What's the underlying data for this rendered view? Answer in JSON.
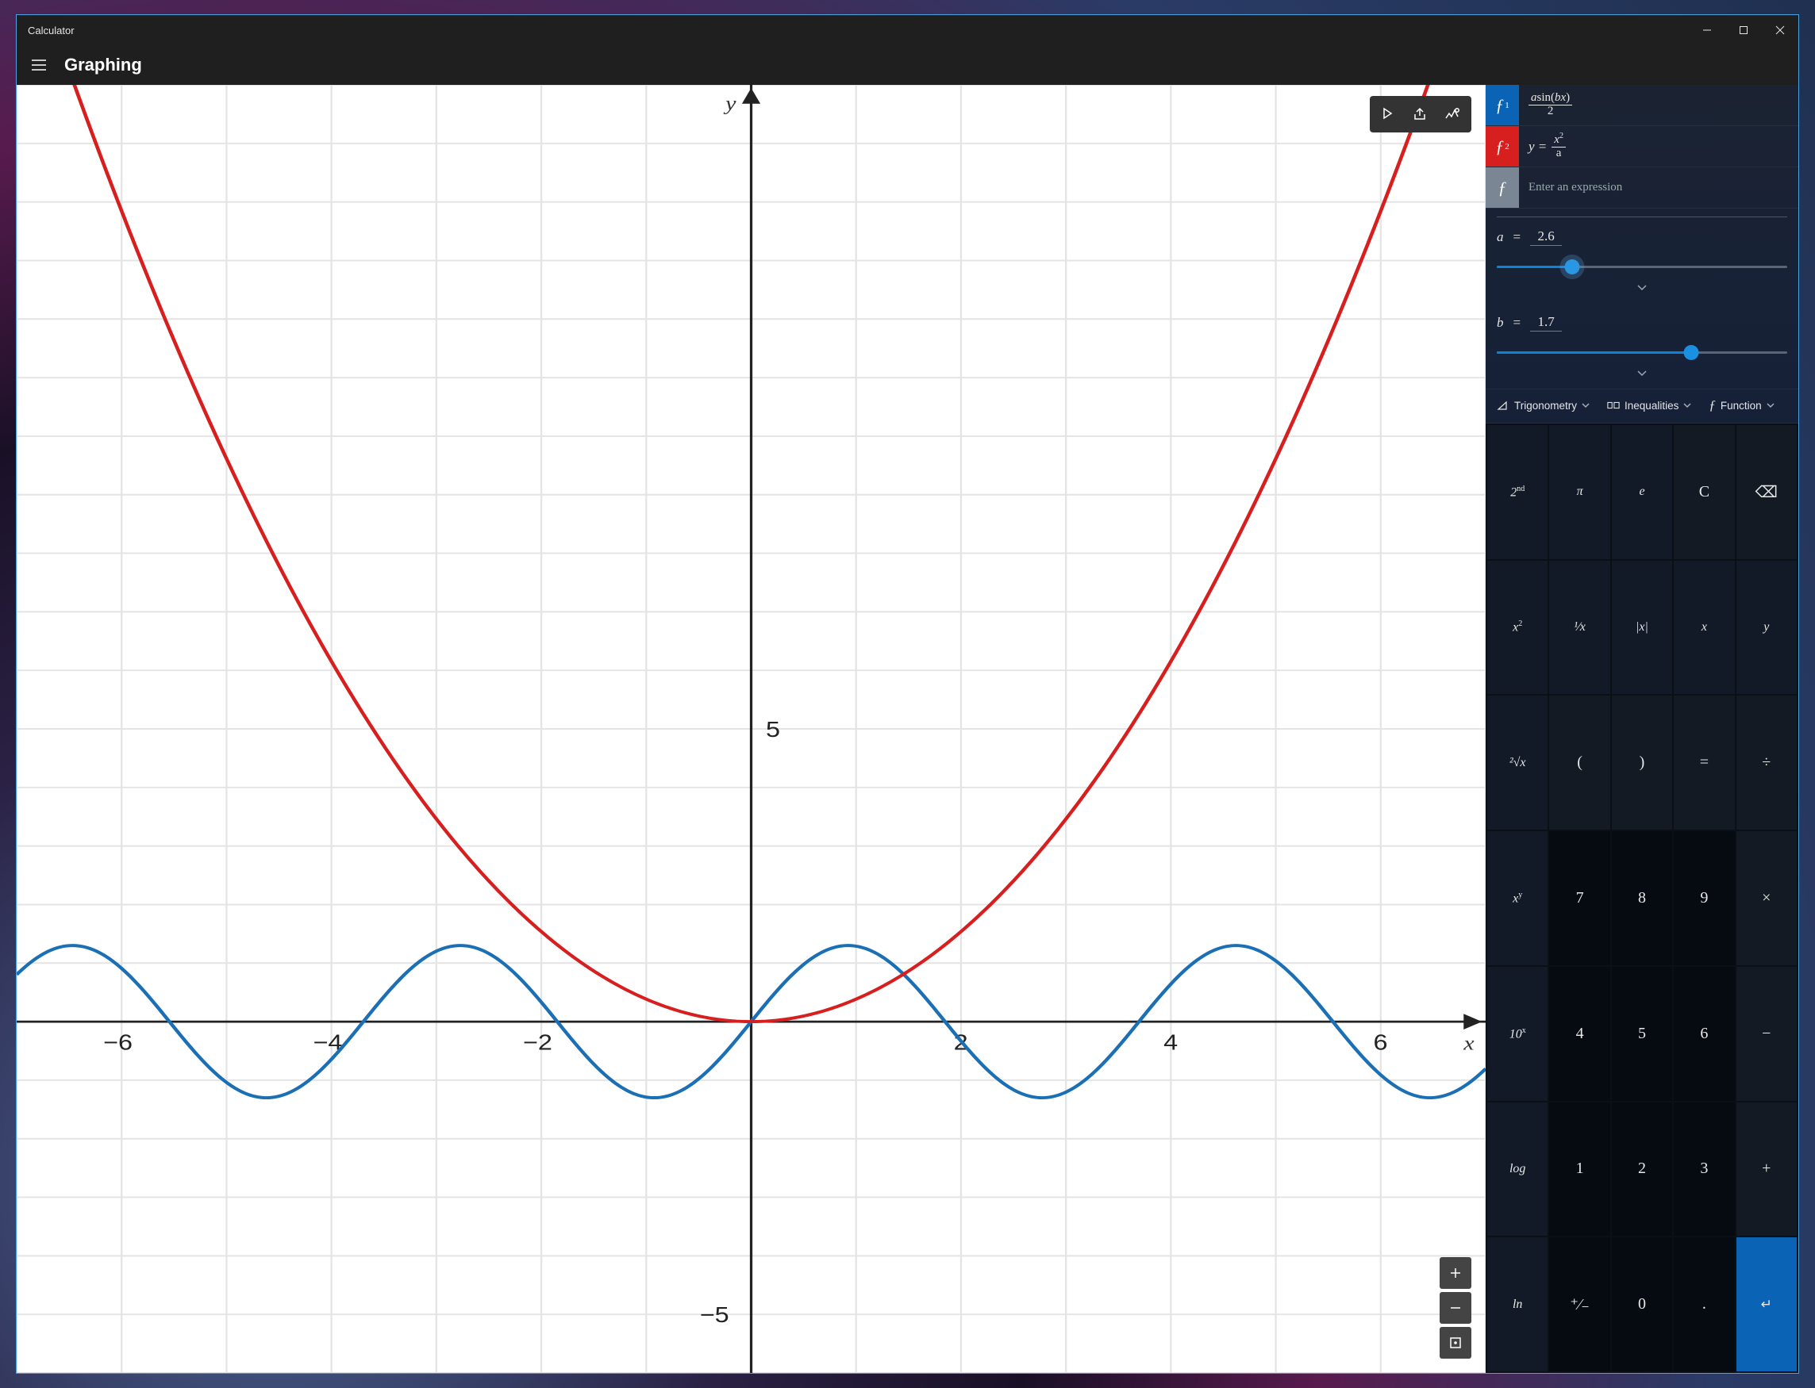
{
  "window": {
    "title": "Calculator"
  },
  "header": {
    "mode": "Graphing"
  },
  "graph": {
    "x_axis_label": "x",
    "y_axis_label": "y",
    "x_ticks": [
      -6,
      -4,
      -2,
      2,
      4,
      6
    ],
    "y_ticks_pos": [
      5
    ],
    "y_ticks_neg": [
      -5
    ],
    "toolbar": {
      "trace": "trace-tool",
      "share": "share-graph",
      "options": "graph-options"
    },
    "zoom": {
      "in": "zoom-in",
      "out": "zoom-out",
      "fit": "zoom-fit"
    }
  },
  "equations": [
    {
      "id": "f1",
      "badge": "ƒ",
      "sub": "1",
      "color": "#0a63b5",
      "display_numer": "asin(bx)",
      "display_denom": "2"
    },
    {
      "id": "f2",
      "badge": "ƒ",
      "sub": "2",
      "color": "#d81f1f",
      "lhs": "y =",
      "display_numer": "x",
      "numer_sup": "2",
      "display_denom": "a"
    },
    {
      "id": "new",
      "badge": "ƒ",
      "color": "#7a8694",
      "placeholder": "Enter an expression"
    }
  ],
  "variables": [
    {
      "name": "a",
      "value": "2.6",
      "min": 0,
      "max": 10,
      "percent": 26,
      "halo": true
    },
    {
      "name": "b",
      "value": "1.7",
      "min": 0,
      "max": 2.5,
      "percent": 67,
      "halo": false
    }
  ],
  "categories": {
    "trig": "Trigonometry",
    "ineq": "Inequalities",
    "func": "Function"
  },
  "keypad": {
    "rows": [
      [
        {
          "kind": "sci",
          "label": "2",
          "sup": "nd",
          "name": "second-function"
        },
        {
          "kind": "sci",
          "label": "π",
          "name": "pi"
        },
        {
          "kind": "sci",
          "label": "e",
          "name": "euler-e"
        },
        {
          "kind": "op",
          "label": "C",
          "name": "clear"
        },
        {
          "kind": "op",
          "label": "⌫",
          "name": "backspace"
        }
      ],
      [
        {
          "kind": "sci",
          "label": "x",
          "sup": "2",
          "name": "square"
        },
        {
          "kind": "sci",
          "label": "¹⁄x",
          "name": "reciprocal"
        },
        {
          "kind": "sci",
          "label": "|x|",
          "name": "absolute"
        },
        {
          "kind": "sci",
          "label": "x",
          "name": "variable-x"
        },
        {
          "kind": "sci",
          "label": "y",
          "name": "variable-y"
        }
      ],
      [
        {
          "kind": "sci",
          "label": "²√x",
          "name": "sqrt"
        },
        {
          "kind": "op",
          "label": "(",
          "name": "paren-open"
        },
        {
          "kind": "op",
          "label": ")",
          "name": "paren-close"
        },
        {
          "kind": "op",
          "label": "=",
          "name": "equals-op"
        },
        {
          "kind": "op",
          "label": "÷",
          "name": "divide"
        }
      ],
      [
        {
          "kind": "sci",
          "label": "x",
          "sup": "y",
          "name": "power"
        },
        {
          "kind": "num",
          "label": "7",
          "name": "digit-7"
        },
        {
          "kind": "num",
          "label": "8",
          "name": "digit-8"
        },
        {
          "kind": "num",
          "label": "9",
          "name": "digit-9"
        },
        {
          "kind": "op",
          "label": "×",
          "name": "multiply"
        }
      ],
      [
        {
          "kind": "sci",
          "label": "10",
          "sup": "x",
          "name": "ten-power"
        },
        {
          "kind": "num",
          "label": "4",
          "name": "digit-4"
        },
        {
          "kind": "num",
          "label": "5",
          "name": "digit-5"
        },
        {
          "kind": "num",
          "label": "6",
          "name": "digit-6"
        },
        {
          "kind": "op",
          "label": "−",
          "name": "subtract"
        }
      ],
      [
        {
          "kind": "sci",
          "label": "log",
          "name": "log"
        },
        {
          "kind": "num",
          "label": "1",
          "name": "digit-1"
        },
        {
          "kind": "num",
          "label": "2",
          "name": "digit-2"
        },
        {
          "kind": "num",
          "label": "3",
          "name": "digit-3"
        },
        {
          "kind": "op",
          "label": "+",
          "name": "add"
        }
      ],
      [
        {
          "kind": "sci",
          "label": "ln",
          "name": "ln"
        },
        {
          "kind": "num",
          "label": "⁺⁄₋",
          "name": "negate"
        },
        {
          "kind": "num",
          "label": "0",
          "name": "digit-0"
        },
        {
          "kind": "num",
          "label": ".",
          "name": "decimal-point"
        },
        {
          "kind": "accent",
          "label": "↵",
          "name": "enter"
        }
      ]
    ]
  },
  "chart_data": {
    "type": "line",
    "xlim": [
      -7,
      7
    ],
    "ylim": [
      -6,
      16
    ],
    "x_ticks": [
      -6,
      -4,
      -2,
      0,
      2,
      4,
      6
    ],
    "y_ticks": [
      -5,
      0,
      5
    ],
    "xlabel": "x",
    "ylabel": "y",
    "parameters": {
      "a": 2.6,
      "b": 1.7
    },
    "series": [
      {
        "name": "f1",
        "color": "#1a6fb5",
        "formula": "a*sin(b*x)/2",
        "a": 2.6,
        "b": 1.7
      },
      {
        "name": "f2",
        "color": "#d81f1f",
        "formula": "x^2/a",
        "a": 2.6
      }
    ]
  }
}
